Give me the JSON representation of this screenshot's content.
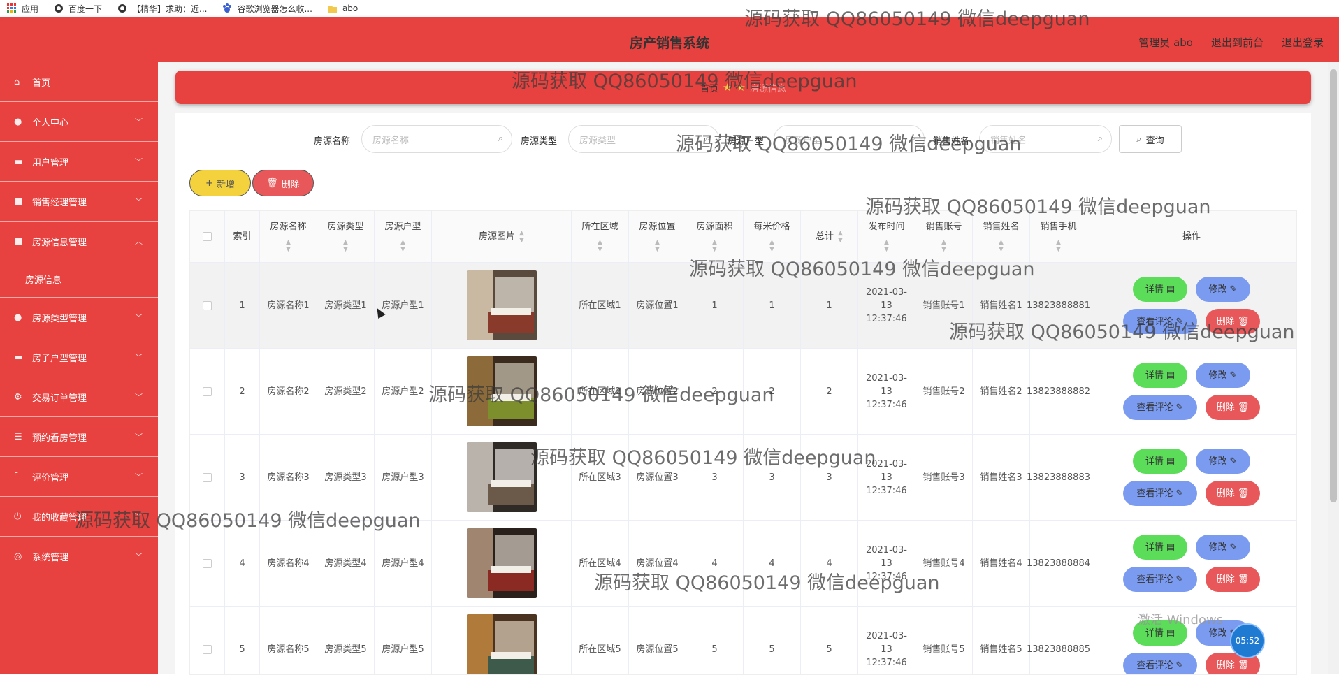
{
  "bookmarks": [
    {
      "label": "应用",
      "icon": "apps-grid-icon"
    },
    {
      "label": "百度一下",
      "icon": "globe-icon"
    },
    {
      "label": "【精华】求助：近...",
      "icon": "globe-icon"
    },
    {
      "label": "谷歌浏览器怎么收...",
      "icon": "paw-icon"
    },
    {
      "label": "abo",
      "icon": "folder-icon"
    }
  ],
  "header": {
    "title": "房产销售系统",
    "admin": "管理员 abo",
    "back": "退出到前台",
    "logout": "退出登录"
  },
  "sidebar": {
    "items": [
      {
        "label": "首页",
        "icon": "home-icon",
        "chevron": ""
      },
      {
        "label": "个人中心",
        "icon": "user-icon",
        "chevron": "﹀"
      },
      {
        "label": "用户管理",
        "icon": "monitor-icon",
        "chevron": "﹀"
      },
      {
        "label": "销售经理管理",
        "icon": "briefcase-icon",
        "chevron": "﹀"
      },
      {
        "label": "房源信息管理",
        "icon": "briefcase-icon",
        "chevron": "︿"
      },
      {
        "label": "房源类型管理",
        "icon": "user-icon",
        "chevron": "﹀"
      },
      {
        "label": "房子户型管理",
        "icon": "monitor-icon",
        "chevron": "﹀"
      },
      {
        "label": "交易订单管理",
        "icon": "settings-icon",
        "chevron": "﹀"
      },
      {
        "label": "预约看房管理",
        "icon": "list-icon",
        "chevron": "﹀"
      },
      {
        "label": "评价管理",
        "icon": "bracket-icon",
        "chevron": "﹀"
      },
      {
        "label": "我的收藏管理",
        "icon": "power-icon",
        "chevron": "﹀"
      },
      {
        "label": "系统管理",
        "icon": "compass-icon",
        "chevron": "﹀"
      }
    ],
    "sub": "房源信息"
  },
  "breadcrumb": {
    "home": "首页",
    "current": "房源信息"
  },
  "search": {
    "fields": [
      {
        "label": "房源名称",
        "placeholder": "房源名称"
      },
      {
        "label": "房源类型",
        "placeholder": "房源类型"
      },
      {
        "label": "房源户型",
        "placeholder": "房源户型"
      },
      {
        "label": "销售姓名",
        "placeholder": "销售姓名"
      }
    ],
    "query": "查询"
  },
  "actions": {
    "add": "新增",
    "delete": "删除"
  },
  "table": {
    "headers": [
      "索引",
      "房源名称",
      "房源类型",
      "房源户型",
      "房源图片",
      "所在区域",
      "房源位置",
      "房源面积",
      "每米价格",
      "总计",
      "发布时间",
      "销售账号",
      "销售姓名",
      "销售手机",
      "操作"
    ],
    "rows": [
      {
        "idx": "1",
        "name": "房源名称1",
        "type": "房源类型1",
        "layout": "房源户型1",
        "area": "所在区域1",
        "pos": "房源位置1",
        "size": "1",
        "price": "1",
        "total": "1",
        "time": "2021-03-13 12:37:46",
        "acct": "销售账号1",
        "sname": "销售姓名1",
        "phone": "13823888881"
      },
      {
        "idx": "2",
        "name": "房源名称2",
        "type": "房源类型2",
        "layout": "房源户型2",
        "area": "所在区域2",
        "pos": "房源位置2",
        "size": "2",
        "price": "2",
        "total": "2",
        "time": "2021-03-13 12:37:46",
        "acct": "销售账号2",
        "sname": "销售姓名2",
        "phone": "13823888882"
      },
      {
        "idx": "3",
        "name": "房源名称3",
        "type": "房源类型3",
        "layout": "房源户型3",
        "area": "所在区域3",
        "pos": "房源位置3",
        "size": "3",
        "price": "3",
        "total": "3",
        "time": "2021-03-13 12:37:46",
        "acct": "销售账号3",
        "sname": "销售姓名3",
        "phone": "13823888883"
      },
      {
        "idx": "4",
        "name": "房源名称4",
        "type": "房源类型4",
        "layout": "房源户型4",
        "area": "所在区域4",
        "pos": "房源位置4",
        "size": "4",
        "price": "4",
        "total": "4",
        "time": "2021-03-13 12:37:46",
        "acct": "销售账号4",
        "sname": "销售姓名4",
        "phone": "13823888884"
      },
      {
        "idx": "5",
        "name": "房源名称5",
        "type": "房源类型5",
        "layout": "房源户型5",
        "area": "所在区域5",
        "pos": "房源位置5",
        "size": "5",
        "price": "5",
        "total": "5",
        "time": "2021-03-13 12:37:46",
        "acct": "销售账号5",
        "sname": "销售姓名5",
        "phone": "13823888885"
      }
    ],
    "ops": {
      "detail": "详情",
      "edit": "修改",
      "comment": "查看评论",
      "delete": "删除"
    }
  },
  "watermark": "源码获取 QQ86050149 微信deepguan",
  "windows": "激活 Windows",
  "clock": "05:52",
  "colors": {
    "primary": "#e7423f",
    "yellow": "#f3d23e",
    "green": "#5bdd5a",
    "blue": "#7a9bf0",
    "danger": "#e8585a"
  }
}
